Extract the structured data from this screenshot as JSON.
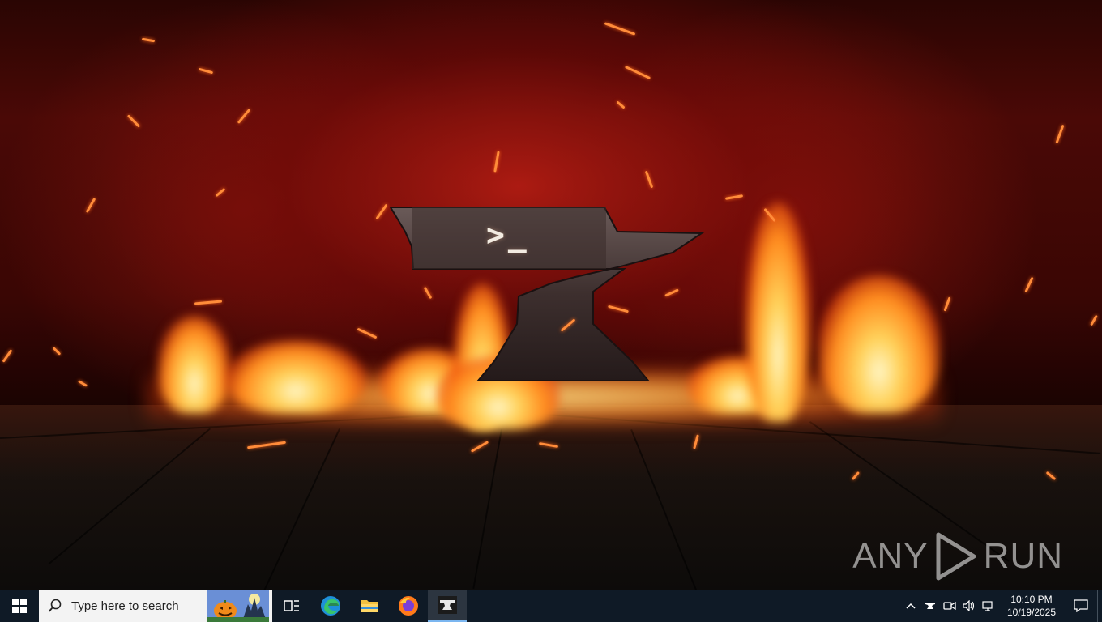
{
  "desktop": {
    "wallpaper": "anvil-in-flames",
    "prompt_text": ">_",
    "watermark": {
      "left": "ANY",
      "right": "RUN"
    }
  },
  "taskbar": {
    "search_placeholder": "Type here to search",
    "apps": [
      "task-view",
      "microsoft-edge",
      "file-explorer",
      "firefox",
      "terminal-app"
    ],
    "clock": {
      "time": "10:10 PM",
      "date": "10/19/2025"
    },
    "colors": {
      "background": "#0f1a26",
      "accent": "#7bb6f0"
    }
  }
}
